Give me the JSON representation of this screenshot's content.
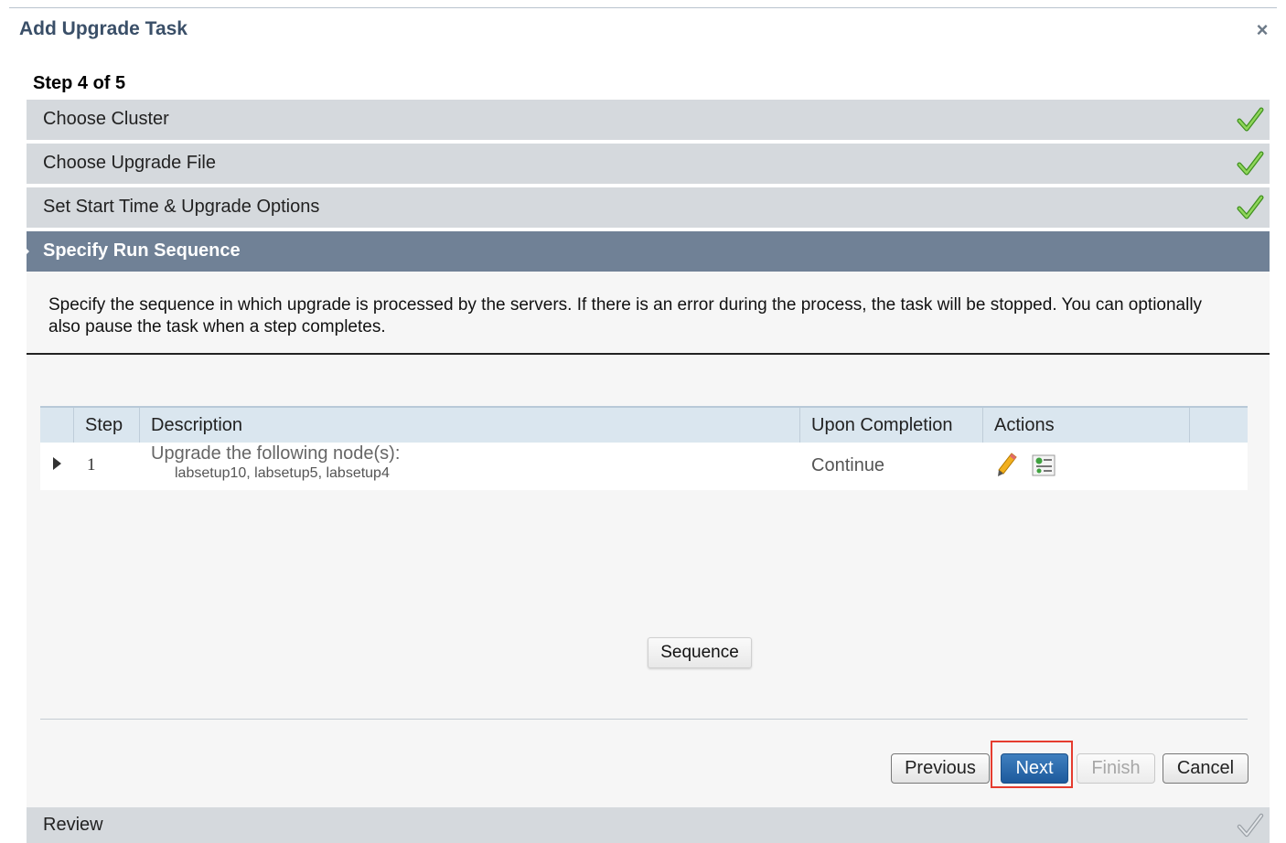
{
  "dialog": {
    "title": "Add Upgrade Task",
    "close_label": "×"
  },
  "wizard": {
    "step_indicator": "Step 4 of 5",
    "completed_steps": [
      {
        "label": "Choose Cluster",
        "status": "complete"
      },
      {
        "label": "Choose Upgrade File",
        "status": "complete"
      },
      {
        "label": "Set Start Time & Upgrade Options",
        "status": "complete"
      }
    ],
    "active_step": {
      "label": "Specify Run Sequence"
    },
    "pending_step": {
      "label": "Review",
      "status": "pending"
    }
  },
  "panel": {
    "instructions": "Specify the sequence in which upgrade is processed by the servers. If there is an error during the process, the task will be stopped. You can optionally also pause the task when a step completes."
  },
  "grid": {
    "columns": [
      "Step",
      "Description",
      "Upon Completion",
      "Actions"
    ],
    "rows": [
      {
        "step": "1",
        "description": "Upgrade the following node(s):",
        "nodes": "labsetup10, labsetup5, labsetup4",
        "upon_completion": "Continue",
        "actions": [
          "pencil-icon",
          "sequence-details-icon"
        ]
      }
    ]
  },
  "buttons": {
    "sequence": "Sequence",
    "previous": "Previous",
    "next": "Next",
    "finish": "Finish",
    "cancel": "Cancel"
  },
  "colors": {
    "active_step_bg": "#708196",
    "step_bg": "#d5d9dd",
    "primary_button": "#1d5a9c",
    "check_green": "#6abf3a",
    "highlight_border": "#e53c2f"
  }
}
